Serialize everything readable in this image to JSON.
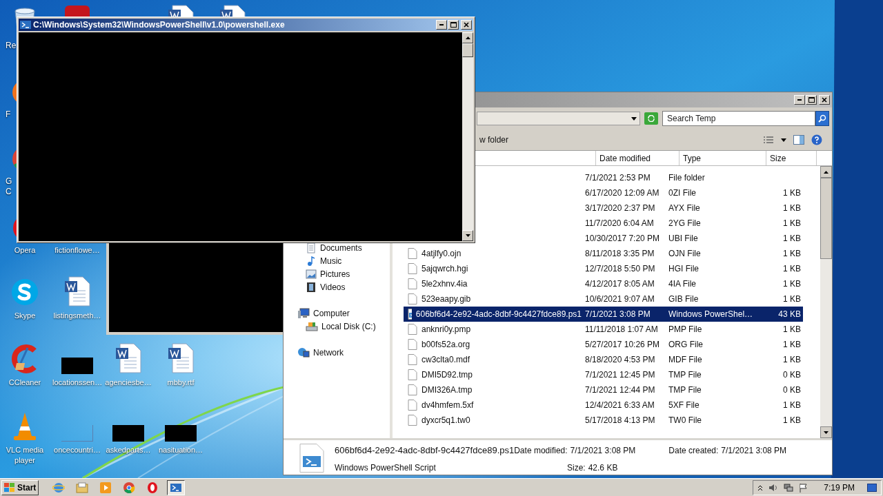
{
  "desktop_icons": [
    {
      "label": "Re",
      "kind": "recycle"
    },
    {
      "label": "F",
      "kind": "firefox"
    },
    {
      "label": "G C",
      "kind": "chrome"
    },
    {
      "label": "Opera",
      "kind": "opera"
    },
    {
      "label": "Skype",
      "kind": "skype"
    },
    {
      "label": "CCleaner",
      "kind": "ccleaner"
    },
    {
      "label": "VLC media player",
      "kind": "vlc"
    },
    {
      "kind": "app"
    },
    {
      "label": "fictionflowe…",
      "kind": "none"
    },
    {
      "label": "listingsmeth…",
      "kind": "word"
    },
    {
      "label": "locationssen…",
      "kind": "redacted"
    },
    {
      "label": "oncecountri…",
      "kind": "blank"
    },
    {
      "label": "agenciesbe…",
      "kind": "word"
    },
    {
      "label": "askedparts…",
      "kind": "redacted"
    },
    {
      "label": "mbby.rtf",
      "kind": "word"
    },
    {
      "label": "nasituation…",
      "kind": "redacted"
    },
    {
      "kind": "word"
    },
    {
      "kind": "word"
    }
  ],
  "powershell_window": {
    "title": "C:\\Windows\\System32\\WindowsPowerShell\\v1.0\\powershell.exe"
  },
  "explorer": {
    "search": {
      "placeholder": "Search Temp"
    },
    "toolbar": {
      "new_folder": "w folder"
    },
    "columns": [
      "Date modified",
      "Type",
      "Size"
    ],
    "nav_items": [
      {
        "label": "Documents",
        "kind": "documents"
      },
      {
        "label": "Music",
        "kind": "music"
      },
      {
        "label": "Pictures",
        "kind": "pictures"
      },
      {
        "label": "Videos",
        "kind": "videos"
      },
      {
        "label": "Computer",
        "kind": "computer"
      },
      {
        "label": "Local Disk (C:)",
        "kind": "disk"
      },
      {
        "label": "Network",
        "kind": "network"
      }
    ],
    "rows": [
      {
        "date": "7/1/2021 2:53 PM",
        "type": "File folder",
        "selected": false
      },
      {
        "date": "6/17/2020 12:09 AM",
        "type": "0ZI File",
        "size": "1 KB",
        "selected": false
      },
      {
        "date": "3/17/2020 2:37 PM",
        "type": "AYX File",
        "size": "1 KB",
        "selected": false
      },
      {
        "date": "11/7/2020 6:04 AM",
        "type": "2YG File",
        "size": "1 KB",
        "selected": false
      },
      {
        "date": "10/30/2017 7:20 PM",
        "type": "UBI File",
        "size": "1 KB",
        "selected": false
      },
      {
        "name": "4atjlfy0.ojn",
        "kind": "file",
        "date": "8/11/2018 3:35 PM",
        "type": "OJN File",
        "size": "1 KB",
        "selected": false
      },
      {
        "name": "5ajqwrch.hgi",
        "kind": "file",
        "date": "12/7/2018 5:50 PM",
        "type": "HGI File",
        "size": "1 KB",
        "selected": false
      },
      {
        "name": "5le2xhnv.4ia",
        "kind": "file",
        "date": "4/12/2017 8:05 AM",
        "type": "4IA File",
        "size": "1 KB",
        "selected": false
      },
      {
        "name": "523eaapy.gib",
        "kind": "file",
        "date": "10/6/2021 9:07 AM",
        "type": "GIB File",
        "size": "1 KB",
        "selected": false
      },
      {
        "name": "606bf6d4-2e92-4adc-8dbf-9c4427fdce89.ps1",
        "kind": "script",
        "date": "7/1/2021 3:08 PM",
        "type": "Windows PowerShel…",
        "size": "43 KB",
        "selected": true
      },
      {
        "name": "anknri0y.pmp",
        "kind": "file",
        "date": "11/11/2018 1:07 AM",
        "type": "PMP File",
        "size": "1 KB",
        "selected": false
      },
      {
        "name": "b00fs52a.org",
        "kind": "file",
        "date": "5/27/2017 10:26 PM",
        "type": "ORG File",
        "size": "1 KB",
        "selected": false
      },
      {
        "name": "cw3clta0.mdf",
        "kind": "file",
        "date": "8/18/2020 4:53 PM",
        "type": "MDF File",
        "size": "1 KB",
        "selected": false
      },
      {
        "name": "DMI5D92.tmp",
        "kind": "file",
        "date": "7/1/2021 12:45 PM",
        "type": "TMP File",
        "size": "0 KB",
        "selected": false
      },
      {
        "name": "DMI326A.tmp",
        "kind": "file",
        "date": "7/1/2021 12:44 PM",
        "type": "TMP File",
        "size": "0 KB",
        "selected": false
      },
      {
        "name": "dv4hmfem.5xf",
        "kind": "file",
        "date": "12/4/2021 6:33 AM",
        "type": "5XF File",
        "size": "1 KB",
        "selected": false
      },
      {
        "name": "dyxcr5q1.tw0",
        "kind": "file",
        "date": "5/17/2018 4:13 PM",
        "type": "TW0 File",
        "size": "1 KB",
        "selected": false
      }
    ],
    "details": {
      "name": "606bf6d4-2e92-4adc-8dbf-9c4427fdce89.ps1",
      "type": "Windows PowerShell Script",
      "date_modified_label": "Date modified:",
      "date_modified": "7/1/2021 3:08 PM",
      "size_label": "Size:",
      "size": "42.6 KB",
      "date_created_label": "Date created:",
      "date_created": "7/1/2021 3:08 PM"
    }
  },
  "taskbar": {
    "start": "Start",
    "apps": [
      {
        "kind": "ie",
        "active": false
      },
      {
        "kind": "explorer",
        "active": false
      },
      {
        "kind": "media",
        "active": false
      },
      {
        "kind": "chrome",
        "active": false
      },
      {
        "kind": "opera",
        "active": false
      },
      {
        "kind": "powershell",
        "active": true
      }
    ],
    "clock": "7:19 PM"
  }
}
